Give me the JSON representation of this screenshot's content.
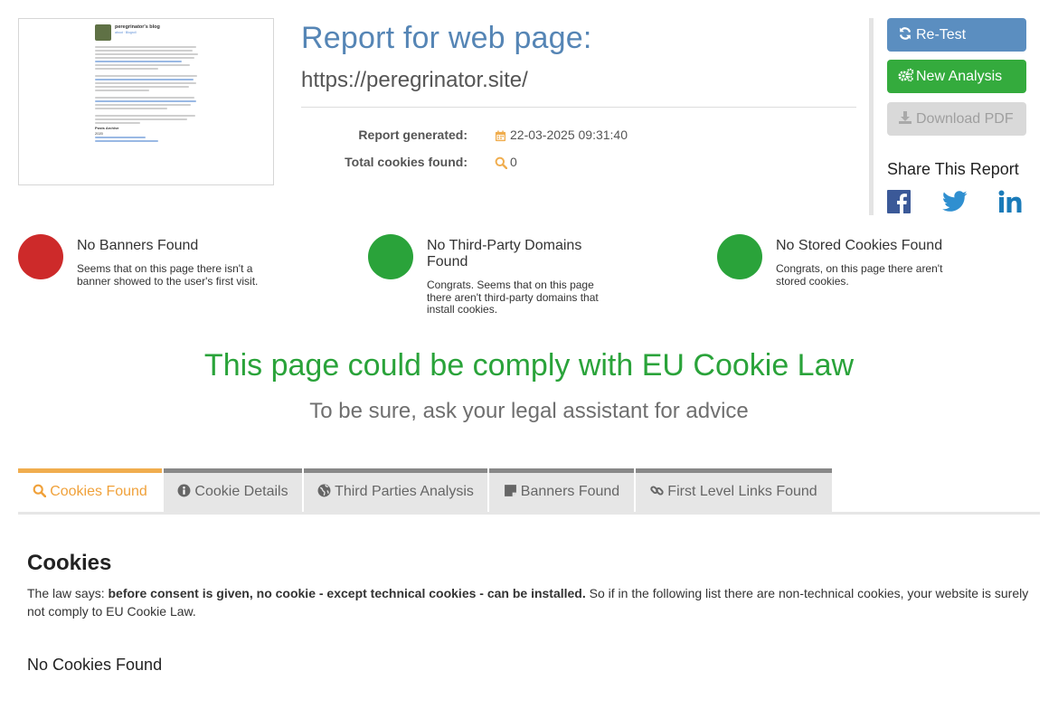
{
  "thumbnail": {
    "blog_title": "peregrinator's blog",
    "blog_nav": "about · Blogroll",
    "posts_heading": "Posts Archive",
    "year": "2020"
  },
  "report": {
    "title": "Report for web page:",
    "url": "https://peregrinator.site/",
    "generated_label": "Report generated:",
    "generated_value": "22-03-2025 09:31:40",
    "cookies_label": "Total cookies found:",
    "cookies_value": "0"
  },
  "actions": {
    "retest": "Re-Test",
    "new_analysis": "New Analysis",
    "download_pdf": "Download PDF",
    "share_title": "Share This Report"
  },
  "statuses": [
    {
      "title": "No Banners Found",
      "desc": "Seems that on this page there isn't a banner showed to the user's first visit.",
      "color": "#cd2a2a"
    },
    {
      "title": "No Third-Party Domains Found",
      "desc": "Congrats. Seems that on this page there aren't third-party domains that install cookies.",
      "color": "#2aa33a"
    },
    {
      "title": "No Stored Cookies Found",
      "desc": "Congrats, on this page there aren't stored cookies.",
      "color": "#2aa33a"
    }
  ],
  "verdict": "This page could be comply with EU Cookie Law",
  "advice": "To be sure, ask your legal assistant for advice",
  "tabs": [
    {
      "label": "Cookies Found",
      "icon": "search-icon",
      "active": true
    },
    {
      "label": "Cookie Details",
      "icon": "info-icon",
      "active": false
    },
    {
      "label": "Third Parties Analysis",
      "icon": "globe-icon",
      "active": false
    },
    {
      "label": "Banners Found",
      "icon": "sticky-note-icon",
      "active": false
    },
    {
      "label": "First Level Links Found",
      "icon": "link-icon",
      "active": false
    }
  ],
  "panel": {
    "title": "Cookies",
    "law_prefix": "The law says: ",
    "law_bold": "before consent is given, no cookie - except technical cookies - can be installed.",
    "law_suffix": " So if in the following list there are non-technical cookies, your website is surely not comply to EU Cookie Law.",
    "empty": "No Cookies Found"
  },
  "colors": {
    "title_blue": "#5585b5",
    "accent_orange": "#f0ad4e",
    "success_green": "#2aa33a",
    "danger_red": "#cd2a2a",
    "facebook": "#3b5998",
    "twitter": "#2f8fd0",
    "linkedin": "#1a7bb9"
  }
}
